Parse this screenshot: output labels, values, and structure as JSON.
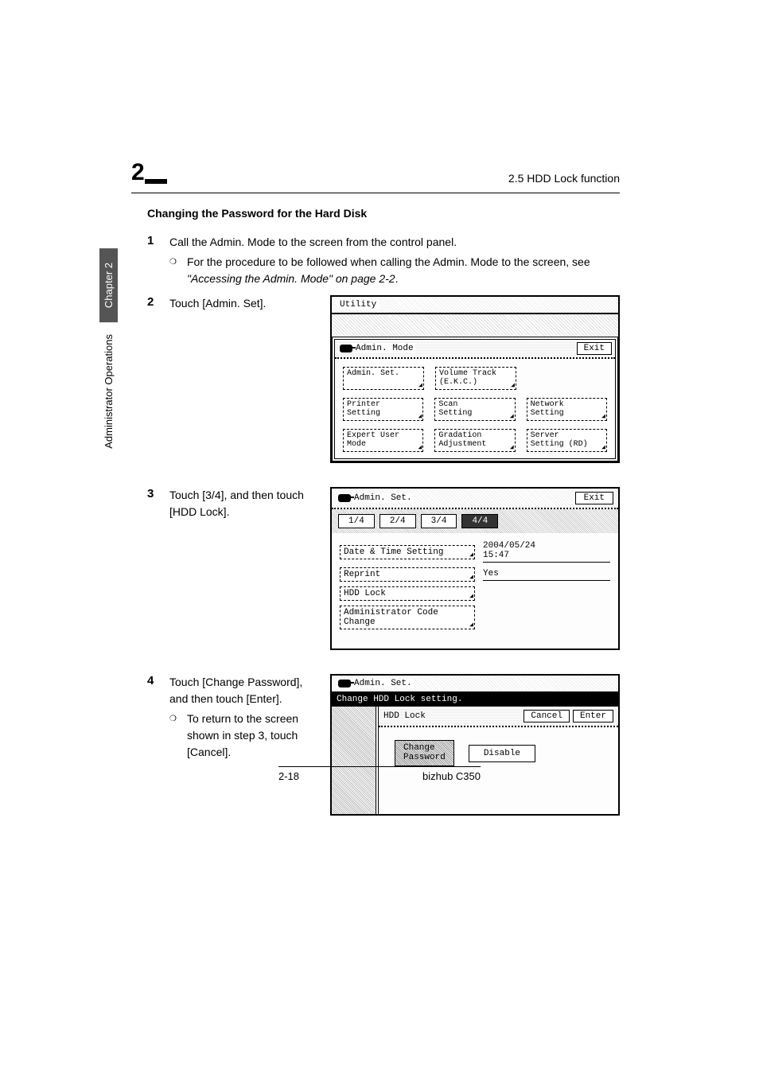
{
  "header": {
    "chapter_number": "2",
    "title_right": "2.5 HDD Lock function"
  },
  "side_tab": {
    "chapter": "Chapter 2",
    "section": "Administrator Operations"
  },
  "subheading": "Changing the Password for the Hard Disk",
  "steps": {
    "s1": {
      "num": "1",
      "text": "Call the Admin. Mode to the screen from the control panel.",
      "sub_pre": "For the procedure to be followed when calling the Admin. Mode to the screen, see ",
      "sub_italic": "\"Accessing the Admin. Mode\" on page 2-2",
      "sub_post": "."
    },
    "s2": {
      "num": "2",
      "text": "Touch [Admin. Set]."
    },
    "s3": {
      "num": "3",
      "text": "Touch [3/4], and then touch [HDD Lock]."
    },
    "s4": {
      "num": "4",
      "text": "Touch [Change Password], and then touch [Enter].",
      "sub": "To return to the screen shown in step 3, touch [Cancel]."
    }
  },
  "screens": {
    "s1": {
      "utility": "Utility",
      "mode": "Admin. Mode",
      "exit": "Exit",
      "buttons": {
        "admin_set": "Admin. Set.",
        "volume_track": "Volume Track\n(E.K.C.)",
        "printer": "Printer\nSetting",
        "scan": "Scan\nSetting",
        "network": "Network\nSetting",
        "expert": "Expert User\nMode",
        "gradation": "Gradation\nAdjustment",
        "server": "Server\nSetting (RD)"
      }
    },
    "s2": {
      "title": "Admin. Set.",
      "exit": "Exit",
      "tabs": {
        "t1": "1/4",
        "t2": "2/4",
        "t3": "3/4",
        "t4": "4/4"
      },
      "items": {
        "date": {
          "label": "Date & Time Setting",
          "value": "2004/05/24\n15:47"
        },
        "reprint": {
          "label": "Reprint",
          "value": "Yes"
        },
        "hdd": {
          "label": "HDD Lock"
        },
        "admincode": {
          "label": "Administrator Code\nChange"
        }
      }
    },
    "s3": {
      "title": "Admin. Set.",
      "subtitle": "Change HDD Lock setting.",
      "panel_title": "HDD Lock",
      "cancel": "Cancel",
      "enter": "Enter",
      "change_pw": "Change\nPassword",
      "disable": "Disable"
    }
  },
  "footer": {
    "left": "2-18",
    "right": "bizhub C350"
  }
}
